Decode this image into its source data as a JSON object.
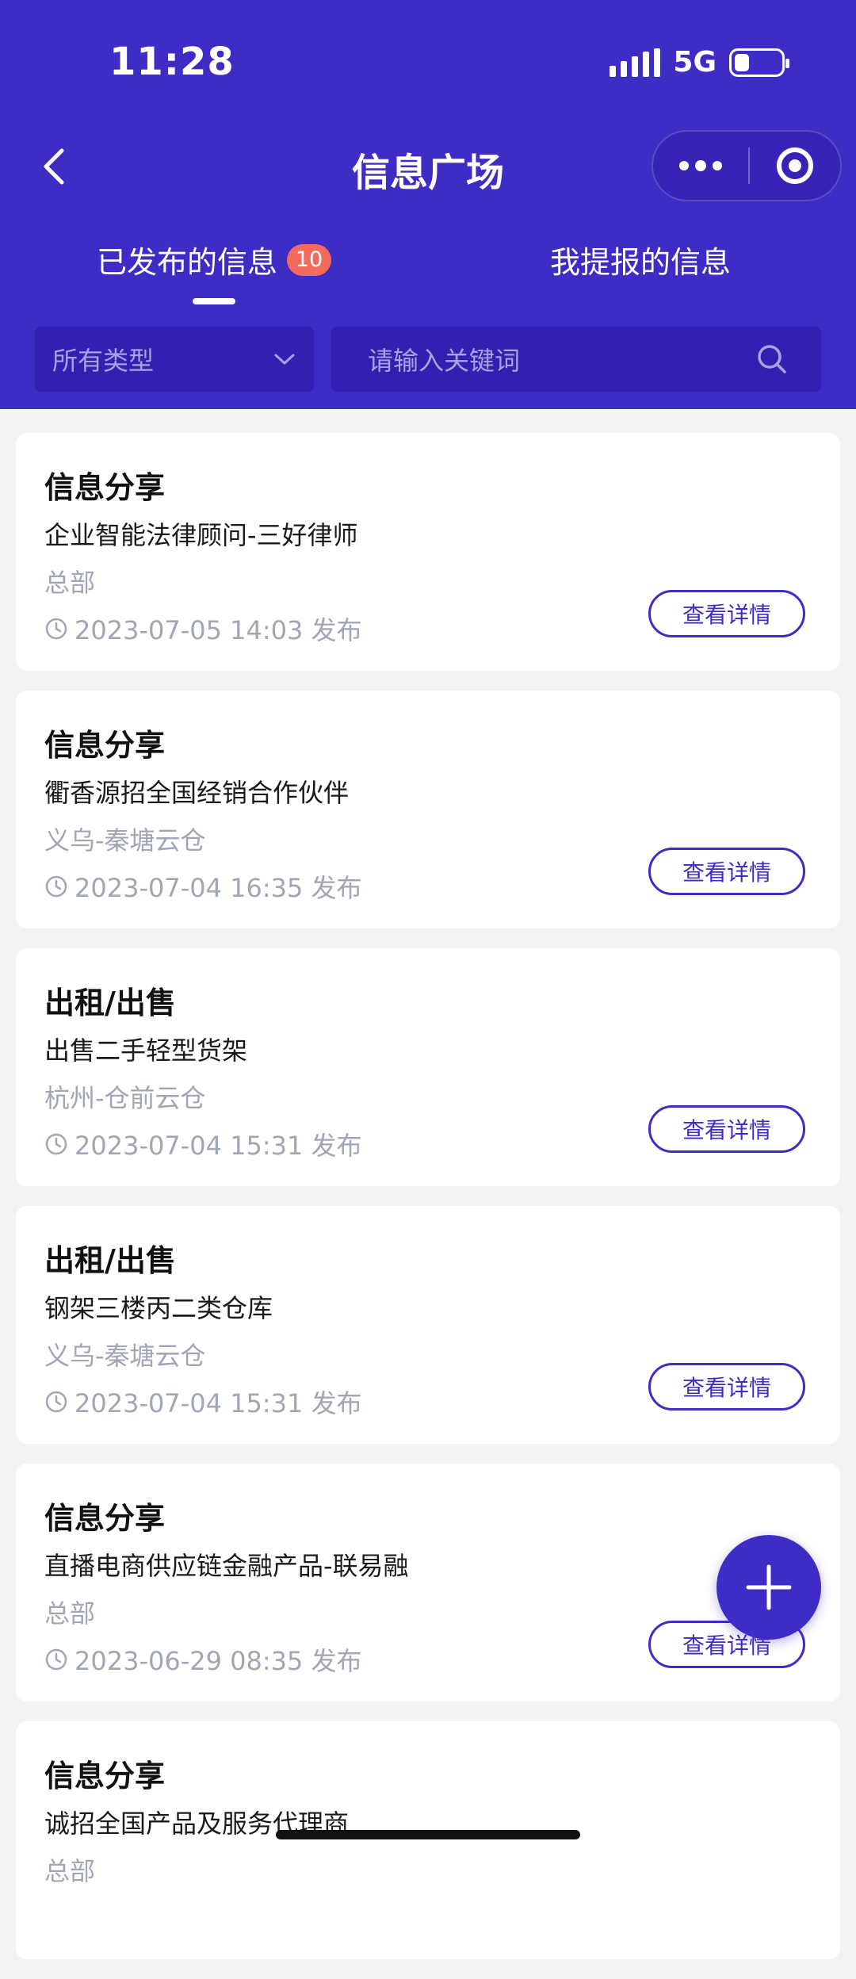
{
  "status_bar": {
    "time": "11:28",
    "network": "5G"
  },
  "nav": {
    "title": "信息广场"
  },
  "tabs": [
    {
      "label": "已发布的信息",
      "badge": "10",
      "active": true
    },
    {
      "label": "我提报的信息",
      "active": false
    }
  ],
  "filters": {
    "type_label": "所有类型",
    "search_placeholder": "请输入关键词"
  },
  "cards": [
    {
      "category": "信息分享",
      "title": "企业智能法律顾问-三好律师",
      "location": "总部",
      "time": "2023-07-05 14:03 发布",
      "button": "查看详情"
    },
    {
      "category": "信息分享",
      "title": "衢香源招全国经销合作伙伴",
      "location": "义乌-秦塘云仓",
      "time": "2023-07-04 16:35 发布",
      "button": "查看详情"
    },
    {
      "category": "出租/出售",
      "title": "出售二手轻型货架",
      "location": "杭州-仓前云仓",
      "time": "2023-07-04 15:31 发布",
      "button": "查看详情"
    },
    {
      "category": "出租/出售",
      "title": "钢架三楼丙二类仓库",
      "location": "义乌-秦塘云仓",
      "time": "2023-07-04 15:31 发布",
      "button": "查看详情"
    },
    {
      "category": "信息分享",
      "title": "直播电商供应链金融产品-联易融",
      "location": "总部",
      "time": "2023-06-29 08:35 发布",
      "button": "查看详情"
    },
    {
      "category": "信息分享",
      "title": "诚招全国产品及服务代理商",
      "location": "总部",
      "time": "",
      "button": ""
    }
  ],
  "colors": {
    "primary": "#3d2dc4",
    "badge": "#f46a5c",
    "muted": "#a0a6b4"
  },
  "icons": [
    "back-icon",
    "more-icon",
    "target-icon",
    "chevron-down-icon",
    "search-icon",
    "clock-icon",
    "plus-icon"
  ]
}
